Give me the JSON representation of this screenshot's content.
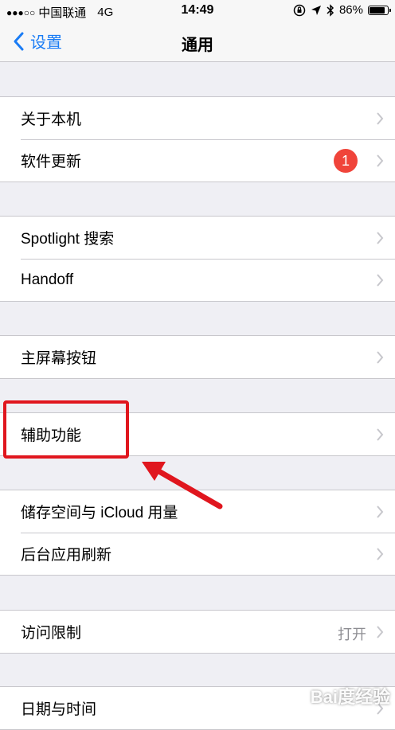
{
  "status_bar": {
    "signal": "●●●○○",
    "carrier": "中国联通",
    "network": "4G",
    "time": "14:49",
    "battery": "86%"
  },
  "nav": {
    "back_label": "设置",
    "title": "通用"
  },
  "groups": [
    {
      "rows": [
        {
          "label": "关于本机"
        },
        {
          "label": "软件更新",
          "badge": "1"
        }
      ]
    },
    {
      "rows": [
        {
          "label": "Spotlight 搜索"
        },
        {
          "label": "Handoff"
        }
      ]
    },
    {
      "rows": [
        {
          "label": "主屏幕按钮"
        }
      ]
    },
    {
      "rows": [
        {
          "label": "辅助功能"
        }
      ]
    },
    {
      "rows": [
        {
          "label": "储存空间与 iCloud 用量"
        },
        {
          "label": "后台应用刷新"
        }
      ]
    },
    {
      "rows": [
        {
          "label": "访问限制",
          "value": "打开"
        }
      ]
    },
    {
      "rows": [
        {
          "label": "日期与时间"
        }
      ]
    }
  ],
  "watermark": "Bai度经验",
  "colors": {
    "accent": "#1a7cf5",
    "badge": "#f0443a",
    "annotation": "#e0161e"
  }
}
